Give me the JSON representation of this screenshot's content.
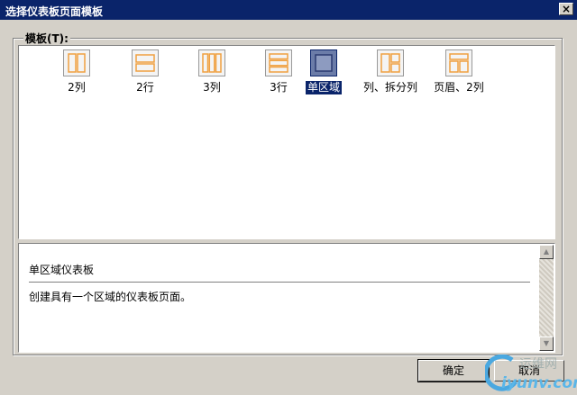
{
  "window": {
    "title": "选择仪表板页面模板",
    "close_glyph": "×"
  },
  "group": {
    "label": "模板(T):"
  },
  "templates": [
    {
      "label": "2列",
      "icon": "two-columns-icon"
    },
    {
      "label": "2行",
      "icon": "two-rows-icon"
    },
    {
      "label": "3列",
      "icon": "three-columns-icon"
    },
    {
      "label": "3行",
      "icon": "three-rows-icon"
    },
    {
      "label": "单区域",
      "icon": "single-region-icon",
      "selected": true
    },
    {
      "label": "列、拆分列",
      "icon": "column-split-column-icon"
    },
    {
      "label": "页眉、2列",
      "icon": "header-two-columns-icon"
    }
  ],
  "description": {
    "title": "单区域仪表板",
    "text": "创建具有一个区域的仪表板页面。"
  },
  "buttons": {
    "ok": "确定",
    "cancel": "取消"
  },
  "watermark": {
    "line1": "运维网",
    "line2": "iyunv.com"
  },
  "colors": {
    "titlebar": "#0a246a",
    "selection": "#0a246a",
    "tile_stroke": "#f0a040"
  }
}
